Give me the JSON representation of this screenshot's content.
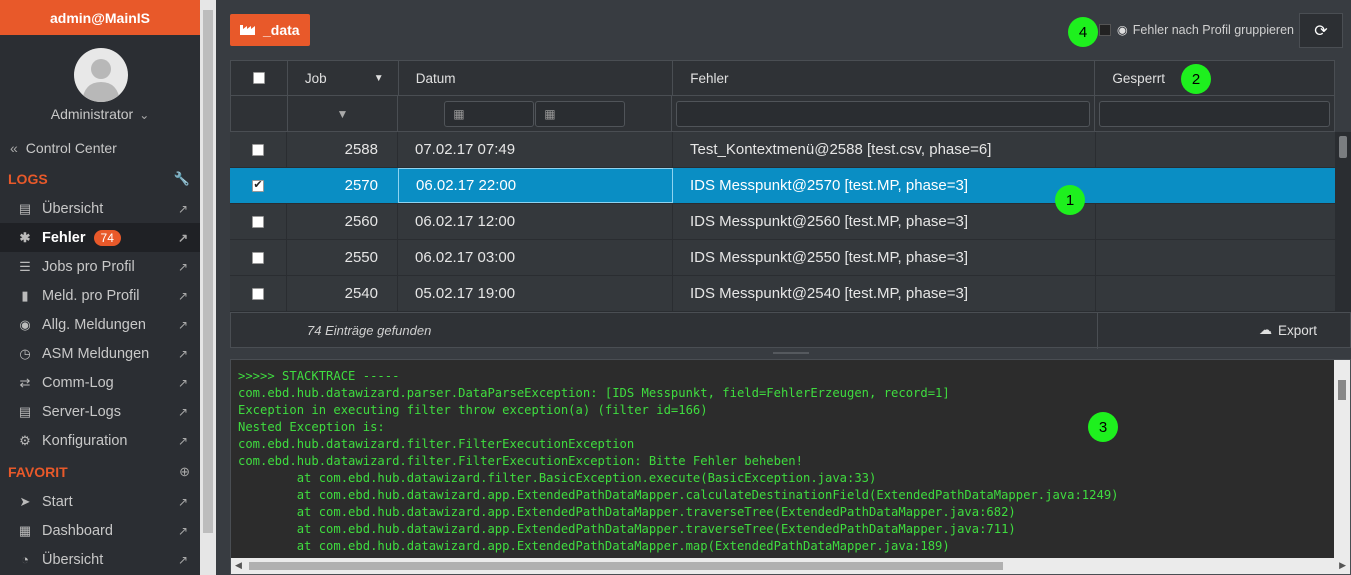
{
  "sidebar": {
    "user": "admin@MainIS",
    "role": "Administrator",
    "control_center": "Control Center",
    "logs_label": "LOGS",
    "favorit_label": "FAVORIT",
    "logs_items": [
      {
        "label": "Übersicht",
        "icon": "document-icon"
      },
      {
        "label": "Fehler",
        "icon": "bug-icon",
        "badge": "74",
        "active": true
      },
      {
        "label": "Jobs pro Profil",
        "icon": "database-icon"
      },
      {
        "label": "Meld. pro Profil",
        "icon": "book-icon"
      },
      {
        "label": "Allg. Meldungen",
        "icon": "globe-icon"
      },
      {
        "label": "ASM Meldungen",
        "icon": "clock-icon"
      },
      {
        "label": "Comm-Log",
        "icon": "exchange-icon"
      },
      {
        "label": "Server-Logs",
        "icon": "file-icon"
      },
      {
        "label": "Konfiguration",
        "icon": "cogs-icon"
      }
    ],
    "favorit_items": [
      {
        "label": "Start",
        "icon": "send-icon"
      },
      {
        "label": "Dashboard",
        "icon": "grid-icon"
      },
      {
        "label": "Übersicht",
        "icon": "pie-chart-icon"
      }
    ]
  },
  "toolbar": {
    "data_button": "_data",
    "group_label": "Fehler nach Profil gruppieren"
  },
  "grid": {
    "columns": [
      "Job",
      "Datum",
      "Fehler",
      "Gesperrt"
    ],
    "rows": [
      {
        "job": "2588",
        "datum": "07.02.17 07:49",
        "fehler": "Test_Kontextmenü@2588 [test.csv, phase=6]",
        "checked": false,
        "selected": false
      },
      {
        "job": "2570",
        "datum": "06.02.17 22:00",
        "fehler": "IDS Messpunkt@2570 [test.MP, phase=3]",
        "checked": true,
        "selected": true
      },
      {
        "job": "2560",
        "datum": "06.02.17 12:00",
        "fehler": "IDS Messpunkt@2560 [test.MP, phase=3]",
        "checked": false,
        "selected": false
      },
      {
        "job": "2550",
        "datum": "06.02.17 03:00",
        "fehler": "IDS Messpunkt@2550 [test.MP, phase=3]",
        "checked": false,
        "selected": false
      },
      {
        "job": "2540",
        "datum": "05.02.17 19:00",
        "fehler": "IDS Messpunkt@2540 [test.MP, phase=3]",
        "checked": false,
        "selected": false
      }
    ],
    "count_text": "74 Einträge gefunden",
    "export_label": "Export"
  },
  "console": {
    "lines": [
      ">>>>> STACKTRACE -----",
      "com.ebd.hub.datawizard.parser.DataParseException: [IDS Messpunkt, field=FehlerErzeugen, record=1]",
      "Exception in executing filter throw exception(a) (filter id=166)",
      "Nested Exception is:",
      "com.ebd.hub.datawizard.filter.FilterExecutionException",
      "com.ebd.hub.datawizard.filter.FilterExecutionException: Bitte Fehler beheben!",
      "        at com.ebd.hub.datawizard.filter.BasicException.execute(BasicException.java:33)",
      "        at com.ebd.hub.datawizard.app.ExtendedPathDataMapper.calculateDestinationField(ExtendedPathDataMapper.java:1249)",
      "        at com.ebd.hub.datawizard.app.ExtendedPathDataMapper.traverseTree(ExtendedPathDataMapper.java:682)",
      "        at com.ebd.hub.datawizard.app.ExtendedPathDataMapper.traverseTree(ExtendedPathDataMapper.java:711)",
      "        at com.ebd.hub.datawizard.app.ExtendedPathDataMapper.map(ExtendedPathDataMapper.java:189)"
    ]
  },
  "markers": [
    "1",
    "2",
    "3",
    "4"
  ],
  "colors": {
    "accent": "#e8592a",
    "selection": "#0a8ec4",
    "console_text": "#3fdc3f",
    "marker": "#1ef01e"
  }
}
